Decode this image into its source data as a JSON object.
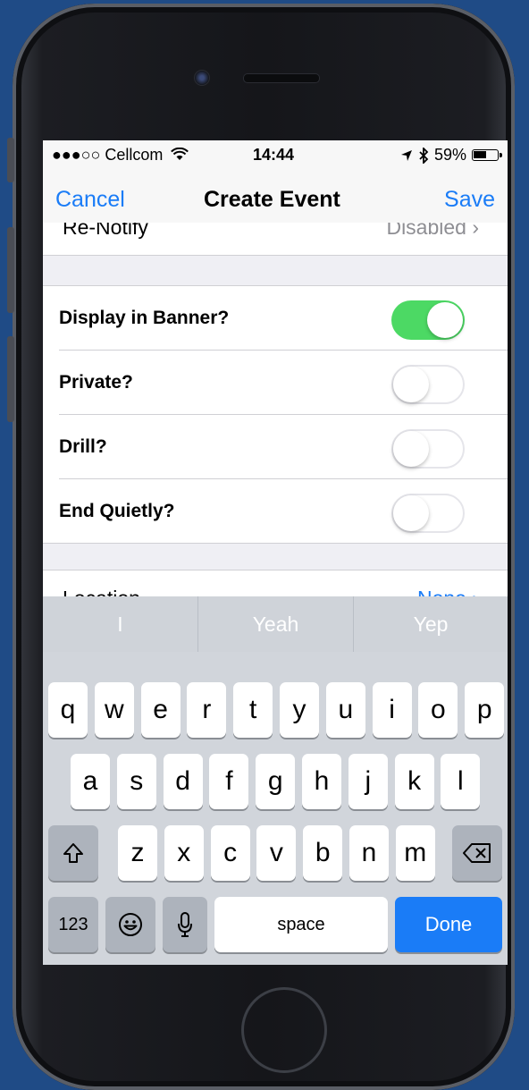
{
  "status_bar": {
    "carrier": "●●●○○ Cellcom",
    "wifi_icon": "wifi-icon",
    "time": "14:44",
    "location_icon": "location-arrow-icon",
    "bluetooth_icon": "bluetooth-icon",
    "battery_percent": "59%",
    "battery_level": 0.59
  },
  "nav": {
    "cancel_label": "Cancel",
    "title": "Create Event",
    "save_label": "Save"
  },
  "partial_row_top": {
    "label": "Re-Notify",
    "value": "Disabled ›"
  },
  "toggles": [
    {
      "label": "Display in Banner?",
      "on": true
    },
    {
      "label": "Private?",
      "on": false
    },
    {
      "label": "Drill?",
      "on": false
    },
    {
      "label": "End Quietly?",
      "on": false
    }
  ],
  "partial_row_bottom": {
    "label": "Location",
    "value": "None ›"
  },
  "keyboard": {
    "suggestions": [
      "I",
      "Yeah",
      "Yep"
    ],
    "row1": [
      "q",
      "w",
      "e",
      "r",
      "t",
      "y",
      "u",
      "i",
      "o",
      "p"
    ],
    "row2": [
      "a",
      "s",
      "d",
      "f",
      "g",
      "h",
      "j",
      "k",
      "l"
    ],
    "row3": [
      "z",
      "x",
      "c",
      "v",
      "b",
      "n",
      "m"
    ],
    "shift_icon": "shift-icon",
    "delete_icon": "delete-icon",
    "numbers_label": "123",
    "emoji_icon": "emoji-icon",
    "mic_icon": "microphone-icon",
    "space_label": "space",
    "done_label": "Done"
  },
  "colors": {
    "accent": "#1a7cf7",
    "switch_on": "#4cd964",
    "background": "#1f4b86"
  }
}
